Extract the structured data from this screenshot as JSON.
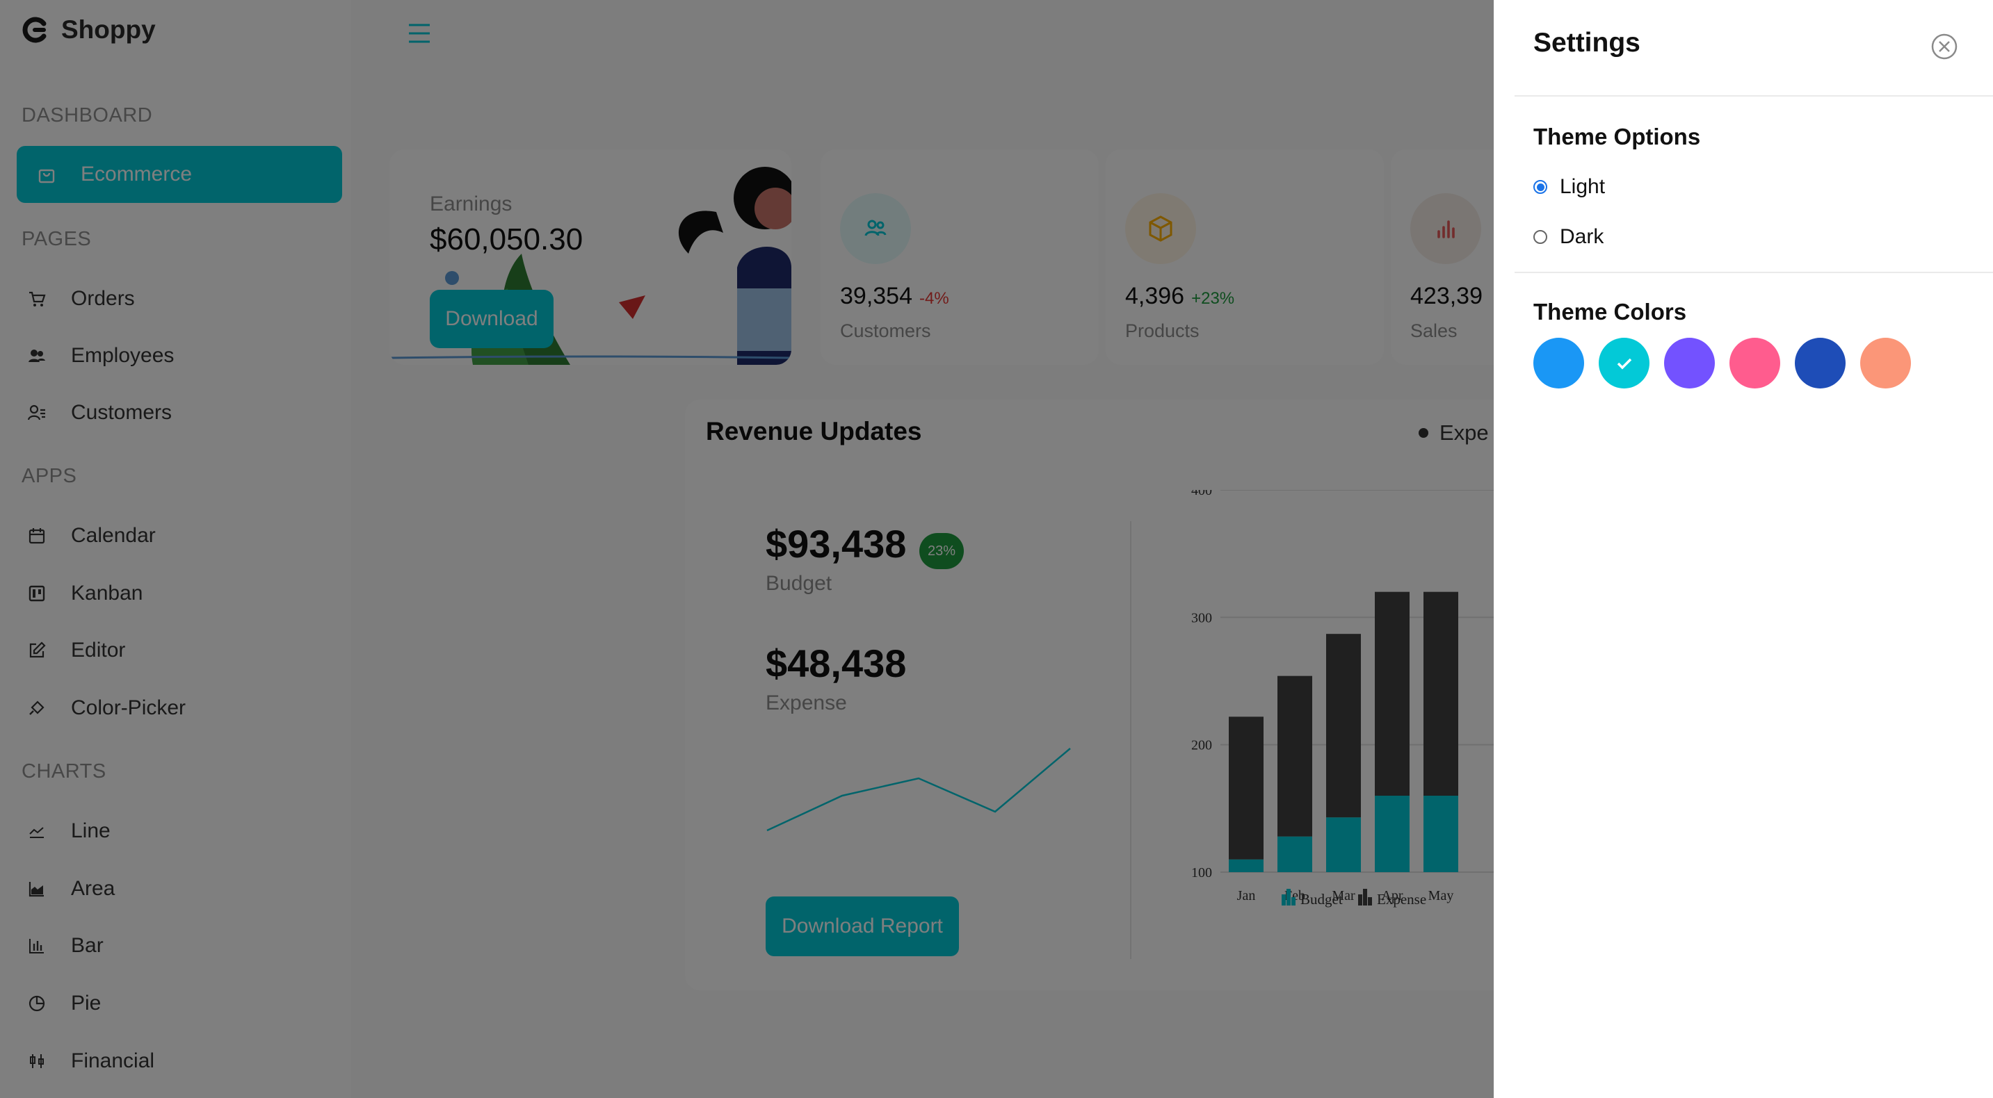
{
  "brand": {
    "name": "Shoppy"
  },
  "sidebar": {
    "sections": [
      {
        "title": "DASHBOARD",
        "items": [
          {
            "label": "Ecommerce",
            "icon": "shopping-bag-icon",
            "active": true
          }
        ]
      },
      {
        "title": "PAGES",
        "items": [
          {
            "label": "Orders",
            "icon": "cart-icon"
          },
          {
            "label": "Employees",
            "icon": "employees-icon"
          },
          {
            "label": "Customers",
            "icon": "customers-icon"
          }
        ]
      },
      {
        "title": "APPS",
        "items": [
          {
            "label": "Calendar",
            "icon": "calendar-icon"
          },
          {
            "label": "Kanban",
            "icon": "kanban-icon"
          },
          {
            "label": "Editor",
            "icon": "edit-icon"
          },
          {
            "label": "Color-Picker",
            "icon": "color-picker-icon"
          }
        ]
      },
      {
        "title": "CHARTS",
        "items": [
          {
            "label": "Line",
            "icon": "line-chart-icon"
          },
          {
            "label": "Area",
            "icon": "area-chart-icon"
          },
          {
            "label": "Bar",
            "icon": "bar-chart-icon"
          },
          {
            "label": "Pie",
            "icon": "pie-chart-icon"
          },
          {
            "label": "Financial",
            "icon": "financial-icon"
          }
        ]
      }
    ]
  },
  "earnings": {
    "title": "Earnings",
    "value": "$60,050.30",
    "button": "Download"
  },
  "stats": [
    {
      "value": "39,354",
      "change": "-4%",
      "label": "Customers",
      "icon": "users-icon",
      "trend": "down"
    },
    {
      "value": "4,396",
      "change": "+23%",
      "label": "Products",
      "icon": "box-icon",
      "trend": "up"
    },
    {
      "value": "423,39",
      "change": "",
      "label": "Sales",
      "icon": "bar-chart-icon",
      "trend": "up"
    }
  ],
  "revenue": {
    "title": "Revenue Updates",
    "legend_label": "Expe",
    "budget_value": "$93,438",
    "budget_badge": "23%",
    "budget_label": "Budget",
    "expense_value": "$48,438",
    "expense_label": "Expense",
    "report_button": "Download Report"
  },
  "chart_data": {
    "type": "bar",
    "stacked": true,
    "categories": [
      "Jan",
      "Feb",
      "Mar",
      "Apr",
      "May"
    ],
    "series": [
      {
        "name": "Budget",
        "values": [
          110,
          128,
          143,
          160,
          160
        ]
      },
      {
        "name": "Expense",
        "values": [
          112,
          126,
          144,
          160,
          160
        ]
      }
    ],
    "y_ticks": [
      100,
      200,
      300,
      400
    ],
    "ylim": [
      100,
      400
    ],
    "legend": [
      "Budget",
      "Expense"
    ]
  },
  "settings": {
    "title": "Settings",
    "theme_options_title": "Theme Options",
    "options": [
      {
        "label": "Light",
        "selected": true
      },
      {
        "label": "Dark",
        "selected": false
      }
    ],
    "theme_colors_title": "Theme Colors",
    "colors": [
      "#1A97F5",
      "#03C9D7",
      "#7352FF",
      "#FF5C8E",
      "#1E4DB7",
      "#FB9678"
    ],
    "selected_color": "#03C9D7"
  }
}
